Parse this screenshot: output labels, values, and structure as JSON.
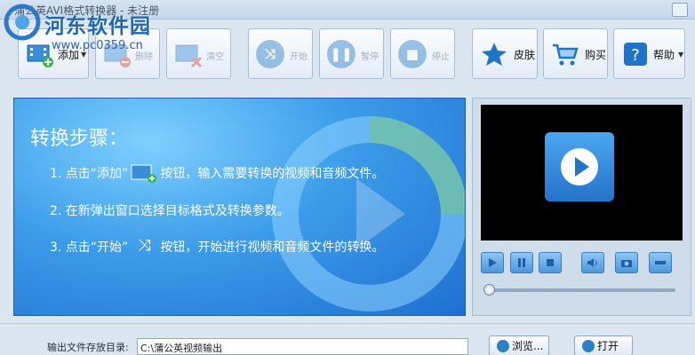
{
  "window": {
    "title": "蒲公英AVI格式转换器 - 未注册"
  },
  "watermark": {
    "text": "河东软件园",
    "url": "www.pc0359.cn"
  },
  "toolbar": {
    "add": "添加",
    "delete": "删除",
    "clear": "清空",
    "start": "开始",
    "pause": "暂停",
    "stop": "停止",
    "skin": "皮肤",
    "buy": "购买",
    "help": "帮助"
  },
  "steps": {
    "title": "转换步骤：",
    "step1_a": "1. 点击“添加”",
    "step1_b": "按钮，输入需要转换的视频和音频文件。",
    "step2": "2. 在新弹出窗口选择目标格式及转换参数。",
    "step3_a": "3. 点击“开始”",
    "step3_b": "按钮，开始进行视频和音频文件的转换。"
  },
  "output": {
    "label": "输出文件存放目录:",
    "path": "C:\\蒲公英视频输出",
    "browse": "浏览...",
    "open": "打开"
  },
  "player": {
    "progress": 0
  },
  "colors": {
    "accent": "#2c7fc9",
    "panel": "#3c9ce9"
  }
}
